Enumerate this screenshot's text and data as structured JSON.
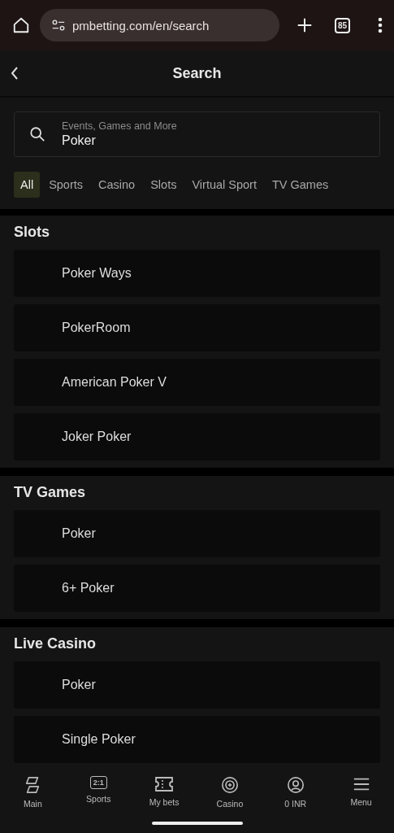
{
  "browser": {
    "url": "pmbetting.com/en/search",
    "tab_count": "85"
  },
  "header": {
    "title": "Search"
  },
  "search": {
    "placeholder": "Events, Games and More",
    "value": "Poker"
  },
  "filters": [
    {
      "label": "All",
      "selected": true
    },
    {
      "label": "Sports",
      "selected": false
    },
    {
      "label": "Casino",
      "selected": false
    },
    {
      "label": "Slots",
      "selected": false
    },
    {
      "label": "Virtual Sport",
      "selected": false
    },
    {
      "label": "TV Games",
      "selected": false
    }
  ],
  "sections": [
    {
      "title": "Slots",
      "items": [
        "Poker Ways",
        "PokerRoom",
        "American Poker V",
        "Joker Poker"
      ]
    },
    {
      "title": "TV Games",
      "items": [
        "Poker",
        "6+ Poker"
      ]
    },
    {
      "title": "Live Casino",
      "items": [
        "Poker",
        "Single Poker"
      ]
    }
  ],
  "nav": [
    {
      "kind": "main",
      "label": "Main"
    },
    {
      "kind": "sports",
      "label": "Sports",
      "icon_text": "2:1"
    },
    {
      "kind": "bets",
      "label": "My bets"
    },
    {
      "kind": "casino",
      "label": "Casino"
    },
    {
      "kind": "account",
      "label": "0 INR"
    },
    {
      "kind": "menu",
      "label": "Menu"
    }
  ]
}
